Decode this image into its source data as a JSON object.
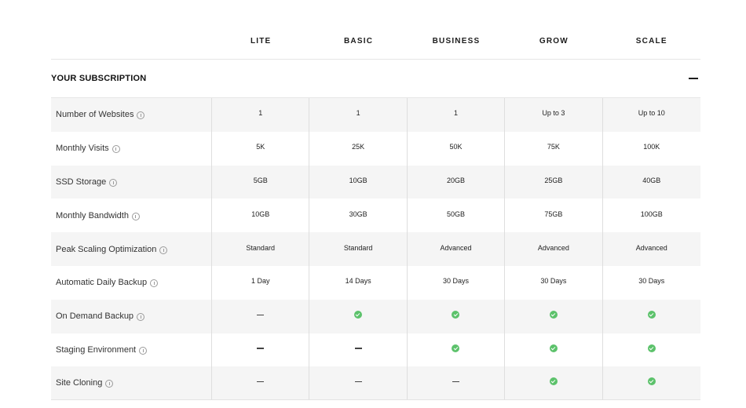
{
  "plans": [
    "LITE",
    "BASIC",
    "BUSINESS",
    "GROW",
    "SCALE"
  ],
  "section": {
    "title": "YOUR SUBSCRIPTION",
    "collapse_icon": "minus-icon"
  },
  "rows": [
    {
      "label": "Number of Websites",
      "values": [
        "1",
        "1",
        "1",
        "Up to 3",
        "Up to 10"
      ]
    },
    {
      "label": "Monthly Visits",
      "values": [
        "5K",
        "25K",
        "50K",
        "75K",
        "100K"
      ]
    },
    {
      "label": "SSD Storage",
      "values": [
        "5GB",
        "10GB",
        "20GB",
        "25GB",
        "40GB"
      ]
    },
    {
      "label": "Monthly Bandwidth",
      "values": [
        "10GB",
        "30GB",
        "50GB",
        "75GB",
        "100GB"
      ]
    },
    {
      "label": "Peak Scaling Optimization",
      "values": [
        "Standard",
        "Standard",
        "Advanced",
        "Advanced",
        "Advanced"
      ]
    },
    {
      "label": "Automatic Daily Backup",
      "values": [
        "1 Day",
        "14 Days",
        "30 Days",
        "30 Days",
        "30 Days"
      ]
    },
    {
      "label": "On Demand Backup",
      "values": [
        "dash",
        "check",
        "check",
        "check",
        "check"
      ]
    },
    {
      "label": "Staging Environment",
      "values": [
        "dash",
        "dash",
        "check",
        "check",
        "check"
      ]
    },
    {
      "label": "Site Cloning",
      "values": [
        "dash",
        "dash",
        "dash",
        "check",
        "check"
      ]
    }
  ],
  "colors": {
    "check": "#5cc26b",
    "row_alt_bg": "#f5f5f5",
    "divider": "#dedede"
  }
}
